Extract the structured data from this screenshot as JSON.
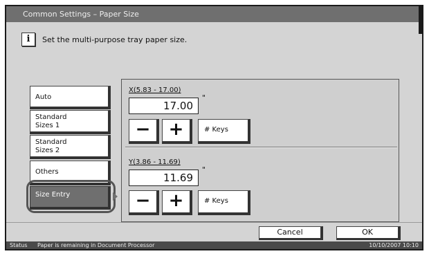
{
  "title": "Common Settings – Paper Size",
  "message": "Set the multi-purpose tray paper size.",
  "info_icon": "i",
  "sidebar": {
    "items": [
      {
        "label": "Auto"
      },
      {
        "label": "Standard\nSizes 1"
      },
      {
        "label": "Standard\nSizes 2"
      },
      {
        "label": "Others"
      },
      {
        "label": "Size Entry",
        "selected": true
      }
    ]
  },
  "x": {
    "range": "X(5.83 - 17.00)",
    "value": "17.00",
    "unit": "\"",
    "minus": "−",
    "plus": "+",
    "keys": "# Keys"
  },
  "y": {
    "range": "Y(3.86 - 11.69)",
    "value": "11.69",
    "unit": "\"",
    "minus": "−",
    "plus": "+",
    "keys": "# Keys"
  },
  "buttons": {
    "cancel": "Cancel",
    "ok": "OK"
  },
  "status": {
    "label": "Status",
    "message": "Paper is remaining in Document Processor",
    "datetime": "10/10/2007   10:10"
  },
  "colors": {
    "selected_bg": "#6f6f6f",
    "titlebar_bg": "#6f6f6f",
    "statusbar_bg": "#4a4a4a",
    "panel_bg": "#d4d4d4"
  }
}
